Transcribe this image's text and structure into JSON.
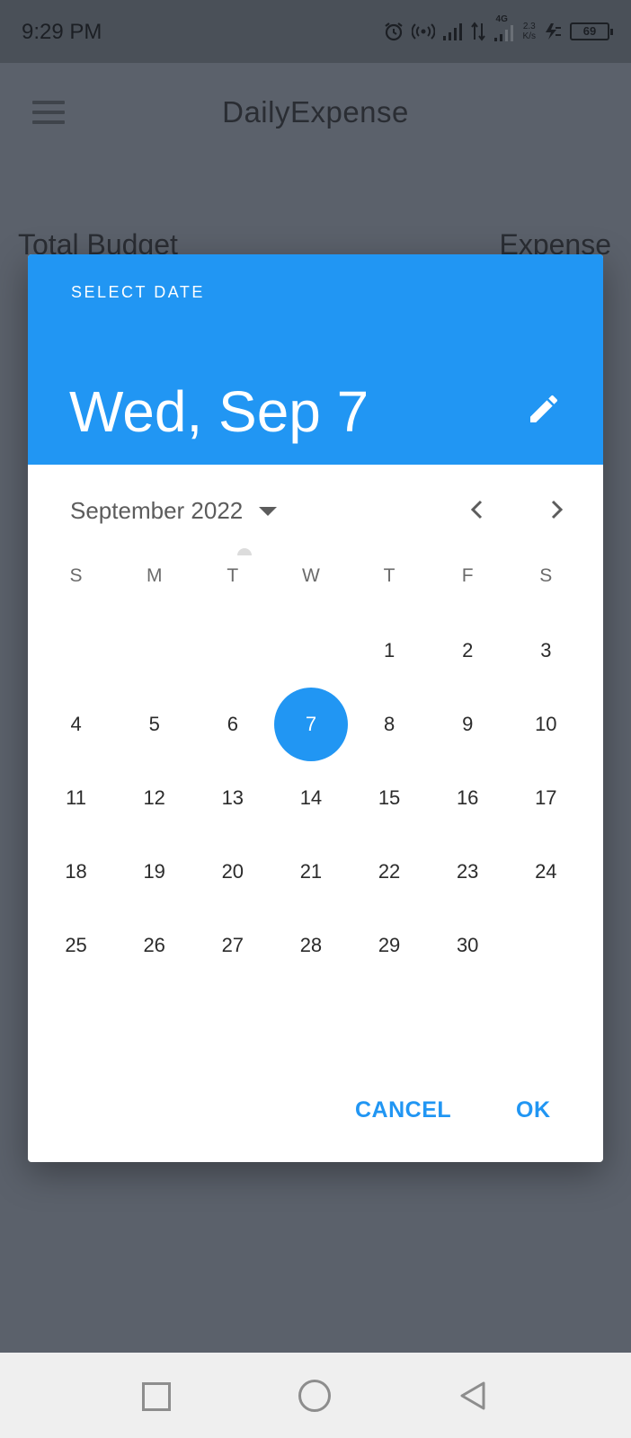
{
  "status_bar": {
    "time": "9:29 PM",
    "network_type": "4G",
    "speed_value": "2.3",
    "speed_unit": "K/s",
    "battery": "69",
    "icons": [
      "alarm-icon",
      "hotspot-icon",
      "signal-icon",
      "data-transfer-icon",
      "signal-4g-icon",
      "charging-icon",
      "battery-icon"
    ]
  },
  "app_bar": {
    "title": "DailyExpense",
    "menu_icon": "hamburger-menu-icon"
  },
  "background": {
    "total_budget_label": "Total Budget",
    "expense_label": "Expense"
  },
  "date_picker": {
    "header_label": "SELECT DATE",
    "selected_date": "Wed, Sep 7",
    "month_label": "September 2022",
    "accent_color": "#2196f3",
    "weekdays": [
      "S",
      "M",
      "T",
      "W",
      "T",
      "F",
      "S"
    ],
    "weeks": [
      [
        "",
        "",
        "",
        "",
        "1",
        "2",
        "3"
      ],
      [
        "4",
        "5",
        "6",
        "7",
        "8",
        "9",
        "10"
      ],
      [
        "11",
        "12",
        "13",
        "14",
        "15",
        "16",
        "17"
      ],
      [
        "18",
        "19",
        "20",
        "21",
        "22",
        "23",
        "24"
      ],
      [
        "25",
        "26",
        "27",
        "28",
        "29",
        "30",
        ""
      ]
    ],
    "selected_day": "7",
    "cancel_label": "CANCEL",
    "ok_label": "OK"
  },
  "nav_bar": {
    "buttons": [
      "recents-icon",
      "home-icon",
      "back-icon"
    ]
  }
}
